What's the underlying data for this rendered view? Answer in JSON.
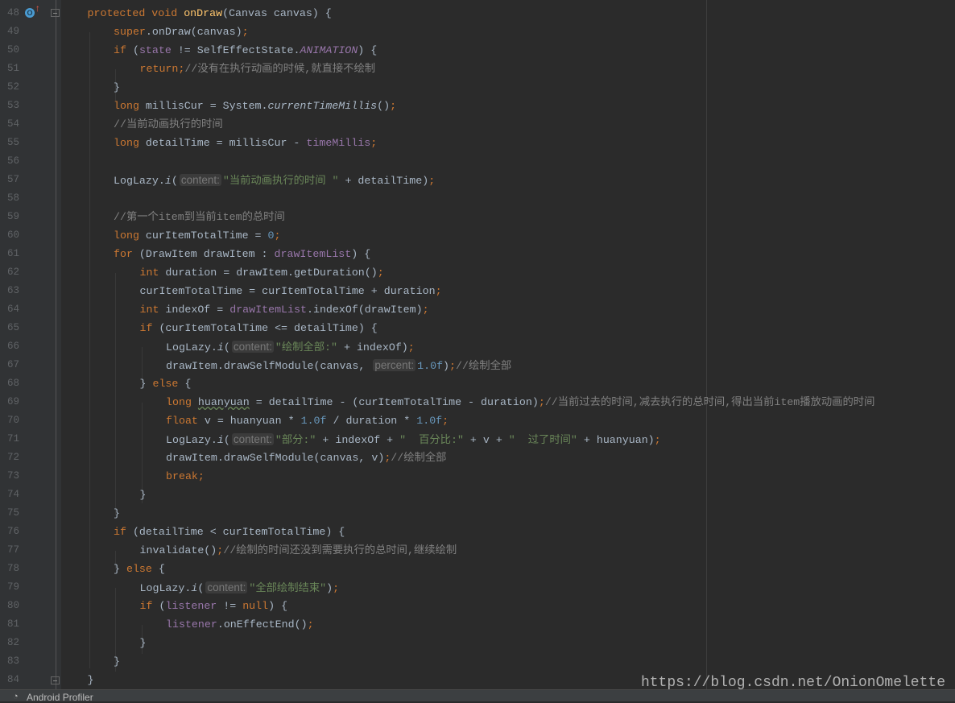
{
  "colors": {
    "background": "#2b2b2b",
    "keyword": "#cc7832",
    "text": "#a9b7c6",
    "field": "#9876aa",
    "string": "#6a8759",
    "number": "#6897bb",
    "comment": "#808080",
    "method": "#ffc66d"
  },
  "gutter": {
    "override_icon_label": "O"
  },
  "lines": [
    {
      "n": "48",
      "indent": 1,
      "tokens": [
        [
          "k",
          "protected void "
        ],
        [
          "m",
          "onDraw"
        ],
        [
          "d",
          "(Canvas canvas) {"
        ]
      ]
    },
    {
      "n": "49",
      "indent": 2,
      "tokens": [
        [
          "k",
          "super"
        ],
        [
          "d",
          ".onDraw(canvas)"
        ],
        [
          "k",
          ";"
        ]
      ]
    },
    {
      "n": "50",
      "indent": 2,
      "tokens": [
        [
          "k",
          "if "
        ],
        [
          "d",
          "("
        ],
        [
          "f",
          "state"
        ],
        [
          "d",
          " != SelfEffectState."
        ],
        [
          "fi",
          "ANIMATION"
        ],
        [
          "d",
          ") {"
        ]
      ]
    },
    {
      "n": "51",
      "indent": 3,
      "tokens": [
        [
          "k",
          "return"
        ],
        [
          "k",
          ";"
        ],
        [
          "c",
          "//没有在执行动画的时候,就直接不绘制"
        ]
      ]
    },
    {
      "n": "52",
      "indent": 2,
      "tokens": [
        [
          "d",
          "}"
        ]
      ]
    },
    {
      "n": "53",
      "indent": 2,
      "tokens": [
        [
          "k",
          "long "
        ],
        [
          "d",
          "millisCur = System."
        ],
        [
          "si",
          "currentTimeMillis"
        ],
        [
          "d",
          "()"
        ],
        [
          "k",
          ";"
        ]
      ]
    },
    {
      "n": "54",
      "indent": 2,
      "tokens": [
        [
          "c",
          "//当前动画执行的时间"
        ]
      ]
    },
    {
      "n": "55",
      "indent": 2,
      "tokens": [
        [
          "k",
          "long "
        ],
        [
          "d",
          "detailTime = millisCur - "
        ],
        [
          "f",
          "timeMillis"
        ],
        [
          "k",
          ";"
        ]
      ]
    },
    {
      "n": "56",
      "indent": 2,
      "tokens": []
    },
    {
      "n": "57",
      "indent": 2,
      "tokens": [
        [
          "d",
          "LogLazy."
        ],
        [
          "si",
          "i"
        ],
        [
          "d",
          "("
        ],
        [
          "h",
          "content:"
        ],
        [
          "s",
          "\"当前动画执行的时间 \""
        ],
        [
          "d",
          " + detailTime)"
        ],
        [
          "k",
          ";"
        ]
      ]
    },
    {
      "n": "58",
      "indent": 2,
      "tokens": []
    },
    {
      "n": "59",
      "indent": 2,
      "tokens": [
        [
          "c",
          "//第一个item到当前item的总时间"
        ]
      ]
    },
    {
      "n": "60",
      "indent": 2,
      "tokens": [
        [
          "k",
          "long "
        ],
        [
          "d",
          "curItemTotalTime = "
        ],
        [
          "n",
          "0"
        ],
        [
          "k",
          ";"
        ]
      ]
    },
    {
      "n": "61",
      "indent": 2,
      "tokens": [
        [
          "k",
          "for "
        ],
        [
          "d",
          "(DrawItem drawItem : "
        ],
        [
          "f",
          "drawItemList"
        ],
        [
          "d",
          ") {"
        ]
      ]
    },
    {
      "n": "62",
      "indent": 3,
      "tokens": [
        [
          "k",
          "int "
        ],
        [
          "d",
          "duration = drawItem.getDuration()"
        ],
        [
          "k",
          ";"
        ]
      ]
    },
    {
      "n": "63",
      "indent": 3,
      "tokens": [
        [
          "d",
          "curItemTotalTime = curItemTotalTime + duration"
        ],
        [
          "k",
          ";"
        ]
      ]
    },
    {
      "n": "64",
      "indent": 3,
      "tokens": [
        [
          "k",
          "int "
        ],
        [
          "d",
          "indexOf = "
        ],
        [
          "f",
          "drawItemList"
        ],
        [
          "d",
          ".indexOf(drawItem)"
        ],
        [
          "k",
          ";"
        ]
      ]
    },
    {
      "n": "65",
      "indent": 3,
      "tokens": [
        [
          "k",
          "if "
        ],
        [
          "d",
          "(curItemTotalTime <= detailTime) {"
        ]
      ]
    },
    {
      "n": "66",
      "indent": 4,
      "tokens": [
        [
          "d",
          "LogLazy."
        ],
        [
          "si",
          "i"
        ],
        [
          "d",
          "("
        ],
        [
          "h",
          "content:"
        ],
        [
          "s",
          "\"绘制全部:\""
        ],
        [
          "d",
          " + indexOf)"
        ],
        [
          "k",
          ";"
        ]
      ]
    },
    {
      "n": "67",
      "indent": 4,
      "tokens": [
        [
          "d",
          "drawItem.drawSelfModule(canvas, "
        ],
        [
          "h",
          "percent:"
        ],
        [
          "n",
          "1.0f"
        ],
        [
          "d",
          ")"
        ],
        [
          "k",
          ";"
        ],
        [
          "c",
          "//绘制全部"
        ]
      ]
    },
    {
      "n": "68",
      "indent": 3,
      "tokens": [
        [
          "d",
          "} "
        ],
        [
          "k",
          "else "
        ],
        [
          "d",
          "{"
        ]
      ]
    },
    {
      "n": "69",
      "indent": 4,
      "tokens": [
        [
          "k",
          "long "
        ],
        [
          "w",
          "huanyuan"
        ],
        [
          "d",
          " = detailTime - (curItemTotalTime - duration)"
        ],
        [
          "k",
          ";"
        ],
        [
          "c",
          "//当前过去的时间,减去执行的总时间,得出当前item播放动画的时间"
        ]
      ]
    },
    {
      "n": "70",
      "indent": 4,
      "tokens": [
        [
          "k",
          "float "
        ],
        [
          "d",
          "v = huanyuan * "
        ],
        [
          "n",
          "1.0f"
        ],
        [
          "d",
          " / duration * "
        ],
        [
          "n",
          "1.0f"
        ],
        [
          "k",
          ";"
        ]
      ]
    },
    {
      "n": "71",
      "indent": 4,
      "tokens": [
        [
          "d",
          "LogLazy."
        ],
        [
          "si",
          "i"
        ],
        [
          "d",
          "("
        ],
        [
          "h",
          "content:"
        ],
        [
          "s",
          "\"部分:\""
        ],
        [
          "d",
          " + indexOf + "
        ],
        [
          "s",
          "\"  百分比:\""
        ],
        [
          "d",
          " + v + "
        ],
        [
          "s",
          "\"  过了时间\""
        ],
        [
          "d",
          " + huanyuan)"
        ],
        [
          "k",
          ";"
        ]
      ]
    },
    {
      "n": "72",
      "indent": 4,
      "tokens": [
        [
          "d",
          "drawItem.drawSelfModule(canvas, v)"
        ],
        [
          "k",
          ";"
        ],
        [
          "c",
          "//绘制全部"
        ]
      ]
    },
    {
      "n": "73",
      "indent": 4,
      "tokens": [
        [
          "k",
          "break"
        ],
        [
          "k",
          ";"
        ]
      ]
    },
    {
      "n": "74",
      "indent": 3,
      "tokens": [
        [
          "d",
          "}"
        ]
      ]
    },
    {
      "n": "75",
      "indent": 2,
      "tokens": [
        [
          "d",
          "}"
        ]
      ]
    },
    {
      "n": "76",
      "indent": 2,
      "tokens": [
        [
          "k",
          "if "
        ],
        [
          "d",
          "(detailTime < curItemTotalTime) {"
        ]
      ]
    },
    {
      "n": "77",
      "indent": 3,
      "tokens": [
        [
          "d",
          "invalidate()"
        ],
        [
          "k",
          ";"
        ],
        [
          "c",
          "//绘制的时间还没到需要执行的总时间,继续绘制"
        ]
      ]
    },
    {
      "n": "78",
      "indent": 2,
      "tokens": [
        [
          "d",
          "} "
        ],
        [
          "k",
          "else "
        ],
        [
          "d",
          "{"
        ]
      ]
    },
    {
      "n": "79",
      "indent": 3,
      "tokens": [
        [
          "d",
          "LogLazy."
        ],
        [
          "si",
          "i"
        ],
        [
          "d",
          "("
        ],
        [
          "h",
          "content:"
        ],
        [
          "s",
          "\"全部绘制结束\""
        ],
        [
          "d",
          ")"
        ],
        [
          "k",
          ";"
        ]
      ]
    },
    {
      "n": "80",
      "indent": 3,
      "tokens": [
        [
          "k",
          "if "
        ],
        [
          "d",
          "("
        ],
        [
          "f",
          "listener"
        ],
        [
          "d",
          " != "
        ],
        [
          "k",
          "null"
        ],
        [
          "d",
          ") {"
        ]
      ]
    },
    {
      "n": "81",
      "indent": 4,
      "tokens": [
        [
          "f",
          "listener"
        ],
        [
          "d",
          ".onEffectEnd()"
        ],
        [
          "k",
          ";"
        ]
      ]
    },
    {
      "n": "82",
      "indent": 3,
      "tokens": [
        [
          "d",
          "}"
        ]
      ]
    },
    {
      "n": "83",
      "indent": 2,
      "tokens": [
        [
          "d",
          "}"
        ]
      ]
    },
    {
      "n": "84",
      "indent": 1,
      "tokens": [
        [
          "d",
          "}"
        ]
      ]
    }
  ],
  "bottom_bar": {
    "tool_window": "Android Profiler"
  },
  "watermark": "https://blog.csdn.net/OnionOmelette"
}
